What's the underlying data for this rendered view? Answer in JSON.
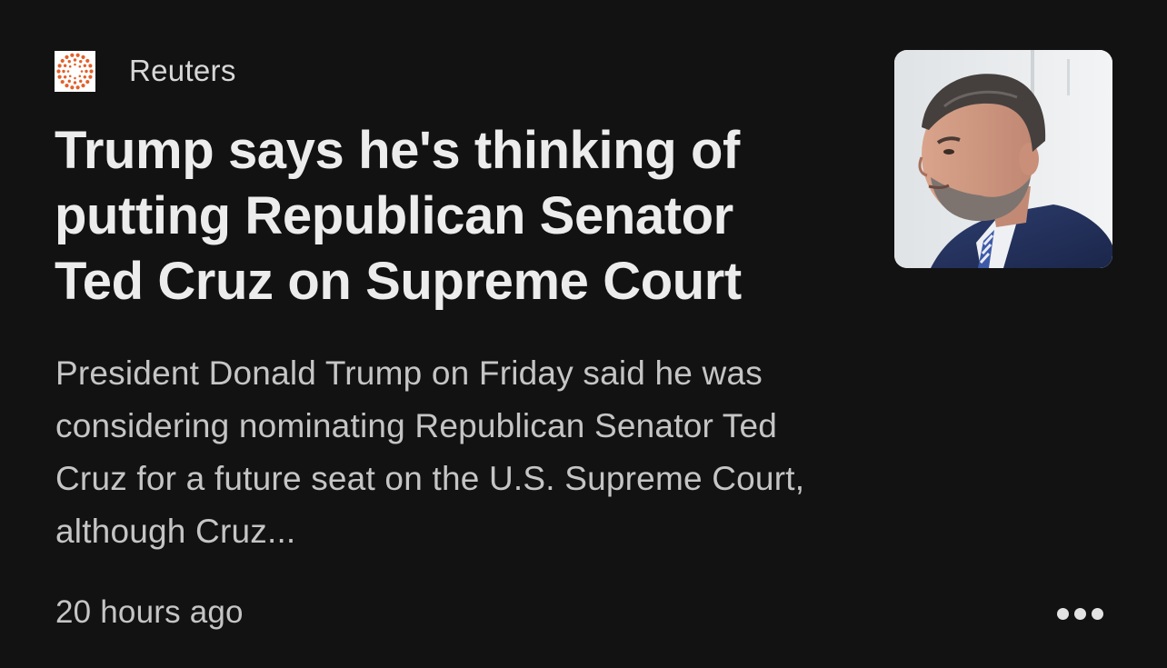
{
  "article": {
    "source": {
      "name": "Reuters",
      "logo_icon": "reuters-logo-icon",
      "logo_color": "#e3602a"
    },
    "headline": "Trump says he's thinking of putting Republican Senator Ted Cruz on Supreme Court",
    "snippet": "President Donald Trump on Friday said he was considering nominating Republican Senator Ted Cruz for a future seat on the U.S. Supreme Court, although Cruz...",
    "timestamp": "20 hours ago",
    "thumbnail": {
      "subject": "portrait-photo"
    },
    "more_icon": "more-horizontal-icon"
  },
  "theme": {
    "background": "#121212",
    "headline_color": "#ececec",
    "secondary_text": "#c5c5c5"
  }
}
